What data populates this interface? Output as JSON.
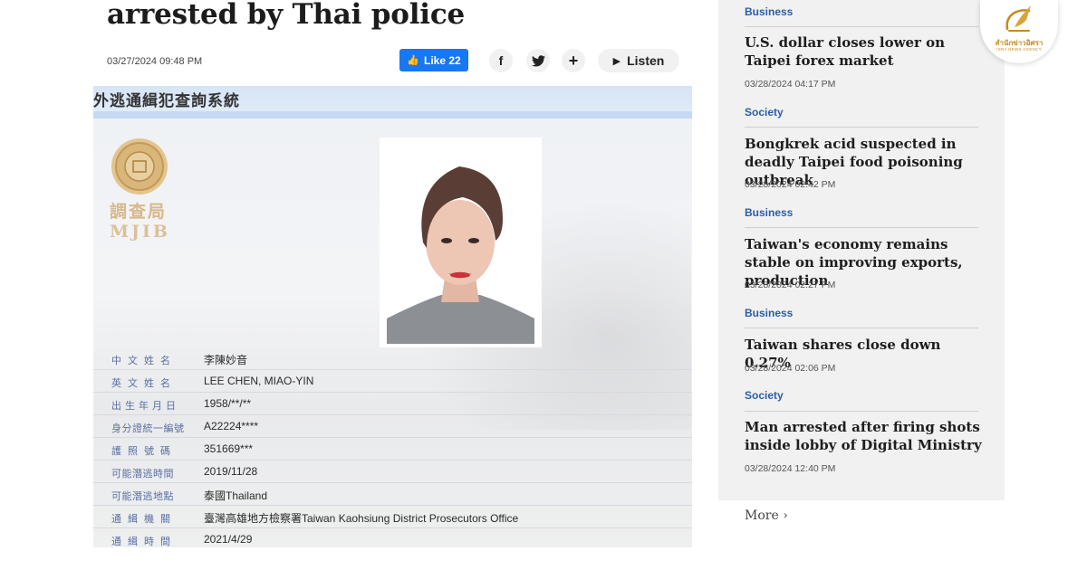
{
  "article": {
    "headline": "arrested by Thai police",
    "date": "03/27/2024 09:48 PM",
    "like_label": "Like 22",
    "listen_label": "Listen",
    "share_icons": [
      "facebook-icon",
      "twitter-icon",
      "plus-icon"
    ]
  },
  "poster": {
    "title": "外逃通緝犯查詢系統",
    "seal_cn": "調查局",
    "seal_en": "MJIB",
    "fields": [
      {
        "label": "中文姓名",
        "value": "李陳妙音"
      },
      {
        "label": "英文姓名",
        "value": "LEE CHEN, MIAO-YIN"
      },
      {
        "label": "出生年月日",
        "value": "1958/**/**"
      },
      {
        "label": "身分證統一編號",
        "value": "A22224****"
      },
      {
        "label": "護照號碼",
        "value": "351669***"
      },
      {
        "label": "可能潛逃時間",
        "value": "2019/11/28"
      },
      {
        "label": "可能潛逃地點",
        "value": "泰國Thailand"
      },
      {
        "label": "通緝機關",
        "value": "臺灣高雄地方檢察署Taiwan Kaohsiung District Prosecutors Office"
      },
      {
        "label": "通緝時間",
        "value": "2021/4/29"
      }
    ]
  },
  "sidebar": {
    "items": [
      {
        "category": "Business",
        "title": "U.S. dollar closes lower on Taipei forex market",
        "time": "03/28/2024 04:17 PM"
      },
      {
        "category": "Society",
        "title": "Bongkrek acid suspected in deadly Taipei food poisoning outbreak",
        "time": "03/28/2024 02:42 PM"
      },
      {
        "category": "Business",
        "title": "Taiwan's economy remains stable on improving exports, production",
        "time": "03/28/2024 02:27 PM"
      },
      {
        "category": "Business",
        "title": "Taiwan shares close down 0.27%",
        "time": "03/28/2024 02:06 PM"
      },
      {
        "category": "Society",
        "title": "Man arrested after firing shots inside lobby of Digital Ministry",
        "time": "03/28/2024 12:40 PM"
      }
    ],
    "more_label": "More"
  },
  "brand": {
    "name": "สำนักข่าวอิศรา",
    "sub": "ISRA NEWS AGENCY"
  },
  "colors": {
    "like_blue": "#1877f2",
    "category_blue": "#2b5ea8",
    "sidebar_bg": "#f1f1f1",
    "brand_gold": "#c58b1d"
  }
}
